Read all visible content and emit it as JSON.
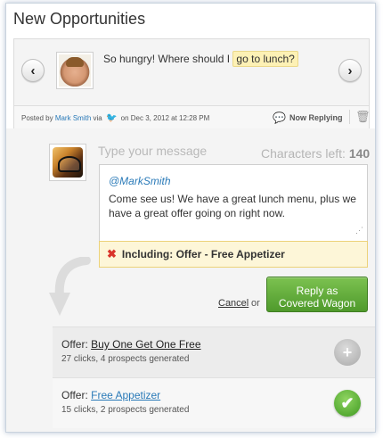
{
  "panel": {
    "title": "New Opportunities"
  },
  "post": {
    "text_before": "So hungry! Where should I",
    "highlight": "go to lunch?",
    "meta": {
      "posted_by": "Posted by",
      "author": "Mark Smith",
      "via": "via",
      "date": "on Dec 3, 2012 at 12:28 PM",
      "now_replying": "Now Replying"
    },
    "icons": {
      "prev": "chevron-left-icon",
      "next": "chevron-right-icon",
      "network": "twitter-bird-icon",
      "trash": "trash-icon"
    }
  },
  "reply": {
    "placeholder": "Type your message",
    "chars_left_label": "Characters left:",
    "chars_left_value": "140",
    "mention": "@MarkSmith",
    "message": "Come see us! We have a great lunch menu, plus we have a great offer going on right now.",
    "including": "Including: Offer - Free Appetizer",
    "cancel": "Cancel",
    "or": "or",
    "submit_line1": "Reply as",
    "submit_line2": "Covered Wagon"
  },
  "offers": [
    {
      "label": "Offer:",
      "name": "Buy One Get One Free",
      "stats": "27 clicks, 4 prospects generated",
      "selected": false
    },
    {
      "label": "Offer:",
      "name": "Free Appetizer",
      "stats": "15 clicks, 2 prospects generated",
      "selected": true
    }
  ],
  "colors": {
    "accent_link": "#2a7ab8",
    "button_green": "#4f9a2c",
    "highlight_yellow": "#fdf1b5",
    "error_red": "#d9342b"
  }
}
